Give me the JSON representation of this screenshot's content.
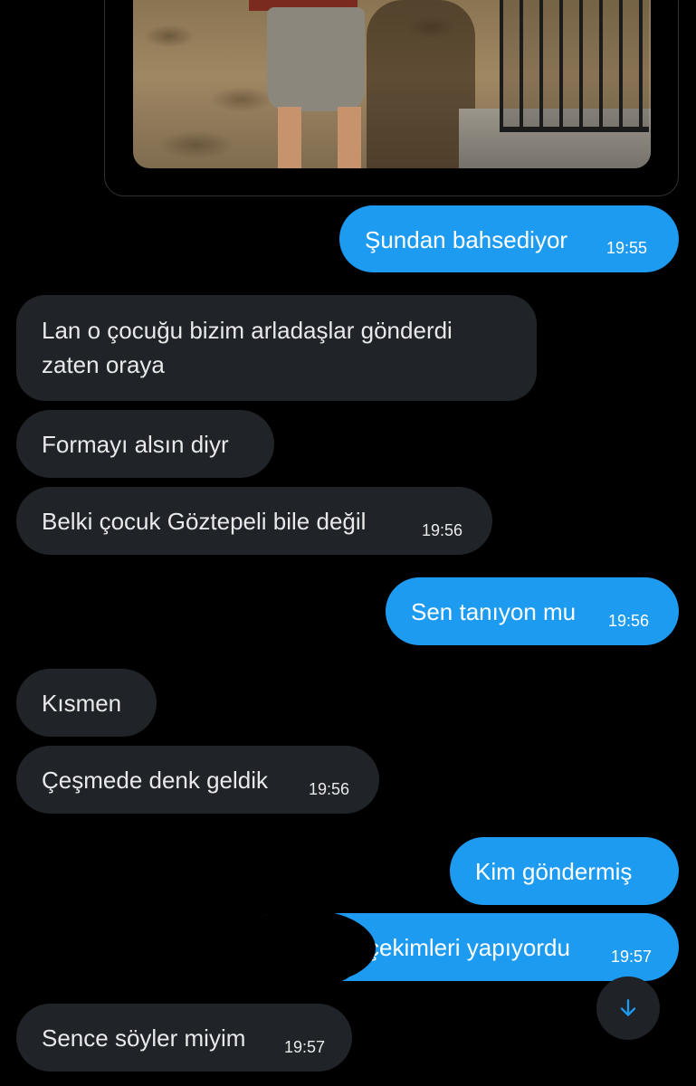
{
  "messages": [
    {
      "text": "Şundan bahsediyor",
      "time": "19:55"
    },
    {
      "text": "Lan o çocuğu bizim arladaşlar gönderdi\nzaten oraya",
      "time": ""
    },
    {
      "text": "Formayı alsın diyr",
      "time": ""
    },
    {
      "text": "Belki çocuk Göztepeli bile değil",
      "time": "19:56"
    },
    {
      "text": "Sen tanıyon mu",
      "time": "19:56"
    },
    {
      "text": "Kısmen",
      "time": ""
    },
    {
      "text": "Çeşmede denk geldik",
      "time": "19:56"
    },
    {
      "text": "Kim göndermiş",
      "time": ""
    },
    {
      "text": "çekimleri yapıyordu",
      "time": "19:57"
    },
    {
      "text": "Sence söyler miyim",
      "time": "19:57"
    }
  ],
  "colors": {
    "sent_bubble": "#1d9bf0",
    "received_bubble": "#202327",
    "background": "#000000",
    "scroll_arrow": "#1d9bf0"
  },
  "icons": {
    "scroll_down": "arrow-down-icon"
  }
}
